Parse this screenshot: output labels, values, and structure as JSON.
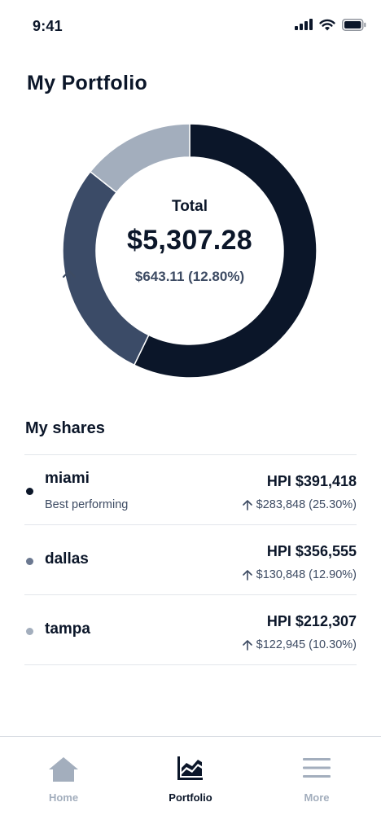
{
  "status_bar": {
    "time": "9:41"
  },
  "title": "My Portfolio",
  "portfolio": {
    "total_label": "Total",
    "total_value": "$5,307.28",
    "change_text": "$643.11 (12.80%)",
    "allocation": [
      {
        "share": "miami",
        "fraction": 0.572,
        "color": "#0b1629"
      },
      {
        "share": "dallas",
        "fraction": 0.285,
        "color": "#3b4b67"
      },
      {
        "share": "tampa",
        "fraction": 0.143,
        "color": "#a3aebd"
      }
    ]
  },
  "shares": {
    "title": "My shares",
    "items": [
      {
        "name": "miami",
        "subtitle": "Best performing",
        "hpi": "HPI $391,418",
        "change": "$283,848 (25.30%)",
        "dot_color": "#0b1629"
      },
      {
        "name": "dallas",
        "subtitle": "",
        "hpi": "HPI $356,555",
        "change": "$130,848 (12.90%)",
        "dot_color": "#6b7890"
      },
      {
        "name": "tampa",
        "subtitle": "",
        "hpi": "HPI $212,307",
        "change": "$122,945 (10.30%)",
        "dot_color": "#a3aebd"
      }
    ]
  },
  "tab_bar": {
    "tabs": [
      {
        "label": "Home",
        "icon": "home-icon",
        "active": false
      },
      {
        "label": "Portfolio",
        "icon": "chart-icon",
        "active": true
      },
      {
        "label": "More",
        "icon": "menu-icon",
        "active": false
      }
    ],
    "active_color": "#0b1629",
    "inactive_color": "#a3aebd"
  }
}
